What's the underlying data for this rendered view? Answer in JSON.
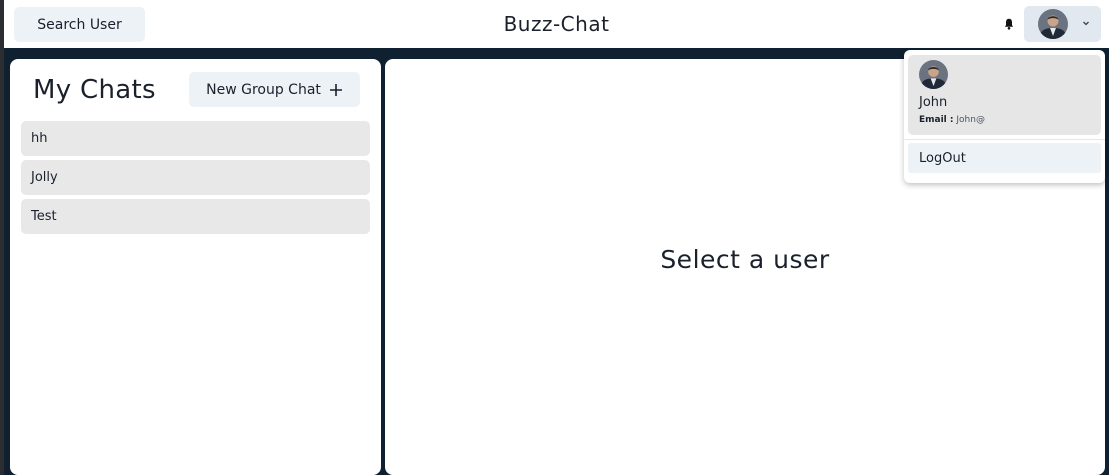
{
  "header": {
    "search_label": "Search User",
    "app_title": "Buzz-Chat",
    "notification_icon": "bell-icon",
    "avatar_icon": "user-avatar",
    "dropdown_icon": "chevron-down-icon"
  },
  "chats": {
    "title": "My Chats",
    "new_group_label": "New Group Chat",
    "add_icon": "plus-icon",
    "items": [
      {
        "name": "hh"
      },
      {
        "name": "Jolly"
      },
      {
        "name": "Test"
      }
    ]
  },
  "main": {
    "placeholder": "Select a user"
  },
  "profile_menu": {
    "name": "John",
    "email_label": "Email :",
    "email_value": "John@",
    "logout_label": "LogOut"
  },
  "colors": {
    "background": "#0f2031",
    "panel": "#ffffff",
    "button": "#edf2f7",
    "chat_item": "#e8e8e8"
  }
}
